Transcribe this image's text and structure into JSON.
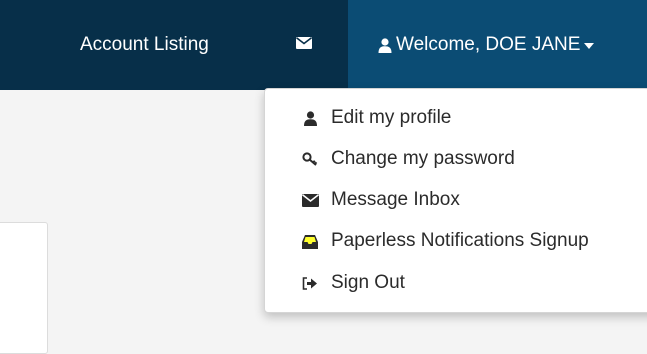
{
  "navbar": {
    "account_listing": "Account Listing",
    "mail_icon": "envelope-icon",
    "welcome": "Welcome, DOE JANE",
    "user_icon": "user-icon"
  },
  "dropdown": {
    "items": [
      {
        "label": "Edit my profile",
        "icon": "user-icon"
      },
      {
        "label": "Change my password",
        "icon": "key-icon"
      },
      {
        "label": "Message Inbox",
        "icon": "envelope-icon"
      },
      {
        "label": "Paperless Notifications Signup",
        "icon": "inbox-icon",
        "highlighted": true
      },
      {
        "label": "Sign Out",
        "icon": "sign-out-icon"
      }
    ]
  },
  "colors": {
    "navbar": "#072f49",
    "navbar_active": "#0b4c74",
    "highlight": "#ffff2e"
  }
}
